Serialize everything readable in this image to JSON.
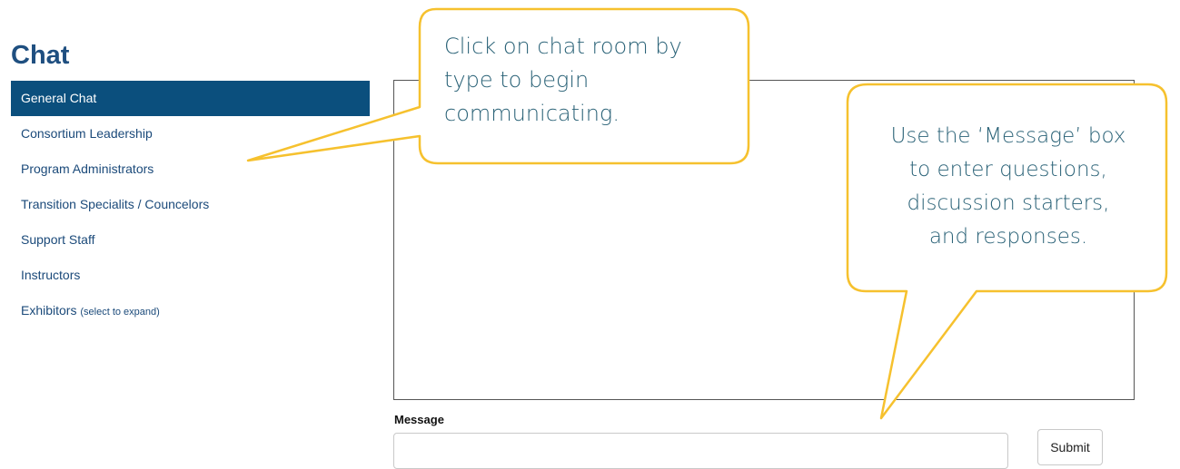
{
  "page": {
    "title": "Chat"
  },
  "rooms": [
    {
      "label": "General Chat",
      "hint": "",
      "active": true
    },
    {
      "label": "Consortium Leadership",
      "hint": ""
    },
    {
      "label": "Program Administrators",
      "hint": ""
    },
    {
      "label": "Transition Specialits / Councelors",
      "hint": ""
    },
    {
      "label": "Support Staff",
      "hint": ""
    },
    {
      "label": "Instructors",
      "hint": ""
    },
    {
      "label": "Exhibitors",
      "hint": "(select to expand)"
    }
  ],
  "message": {
    "label": "Message",
    "value": "",
    "placeholder": ""
  },
  "submit_label": "Submit",
  "callouts": {
    "rooms_tip_lines": [
      "Click on chat room by",
      "type to begin",
      "communicating."
    ],
    "message_tip_lines": [
      "Use the ‘Message’ box",
      "to enter questions,",
      "discussion starters,",
      "and responses."
    ]
  },
  "colors": {
    "accent": "#0b4f7d",
    "callout_border": "#f6c12e",
    "callout_text": "#2a6277"
  }
}
